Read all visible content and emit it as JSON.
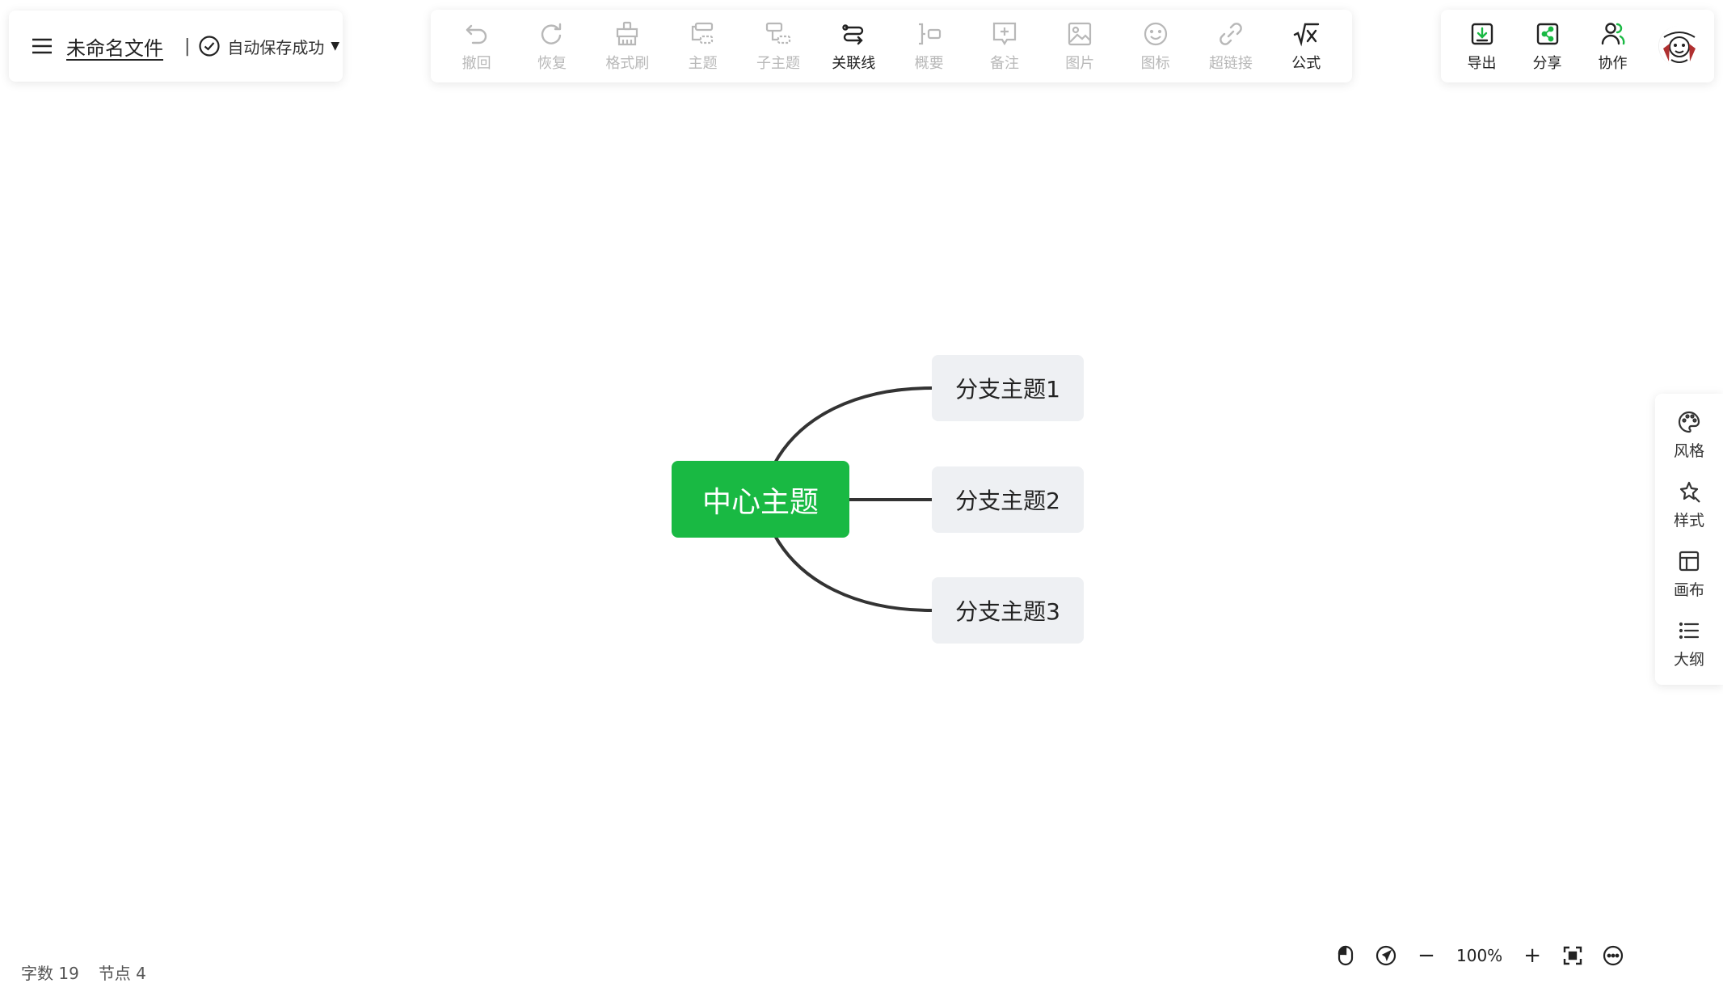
{
  "file": {
    "name": "未命名文件",
    "separator": "|",
    "save_status": "自动保存成功"
  },
  "toolbar": {
    "items": [
      {
        "label": "撤回",
        "icon": "undo-icon",
        "enabled": false
      },
      {
        "label": "恢复",
        "icon": "redo-icon",
        "enabled": false
      },
      {
        "label": "格式刷",
        "icon": "format-brush-icon",
        "enabled": false
      },
      {
        "label": "主题",
        "icon": "topic-icon",
        "enabled": false
      },
      {
        "label": "子主题",
        "icon": "subtopic-icon",
        "enabled": false
      },
      {
        "label": "关联线",
        "icon": "relation-line-icon",
        "enabled": true
      },
      {
        "label": "概要",
        "icon": "summary-icon",
        "enabled": false
      },
      {
        "label": "备注",
        "icon": "note-icon",
        "enabled": false
      },
      {
        "label": "图片",
        "icon": "image-icon",
        "enabled": false
      },
      {
        "label": "图标",
        "icon": "emoji-icon",
        "enabled": false
      },
      {
        "label": "超链接",
        "icon": "link-icon",
        "enabled": false
      },
      {
        "label": "公式",
        "icon": "formula-icon",
        "enabled": true
      }
    ]
  },
  "actions": {
    "export": "导出",
    "share": "分享",
    "collab": "协作"
  },
  "side": {
    "style_theme": "风格",
    "node_style": "样式",
    "canvas": "画布",
    "outline": "大纲"
  },
  "mindmap": {
    "center": "中心主题",
    "branches": [
      "分支主题1",
      "分支主题2",
      "分支主题3"
    ]
  },
  "colors": {
    "accent": "#19b943",
    "branch_bg": "#eef0f3",
    "line": "#333333"
  },
  "status": {
    "word_count_label": "字数",
    "word_count": "19",
    "node_count_label": "节点",
    "node_count": "4"
  },
  "zoom": {
    "level": "100%",
    "minus": "−",
    "plus": "+"
  }
}
